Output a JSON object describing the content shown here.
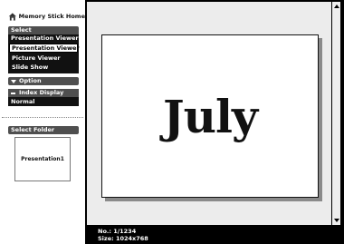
{
  "sidebar": {
    "home_label": "Memory Stick Home",
    "select_label": "Select",
    "select_value": "Presentation Viewer",
    "dropdown_options": [
      "Presentation Viewer",
      "Picture Viewer",
      "Slide Show"
    ],
    "option_label": "Option",
    "index_display_label": "Index Display",
    "index_display_value": "Normal",
    "select_folder_label": "Select Folder",
    "folder_name": "Presentation1"
  },
  "viewer": {
    "slide_title": "July",
    "number_line": "No.: 1/1234",
    "size_line": "Size: 1024x768"
  }
}
